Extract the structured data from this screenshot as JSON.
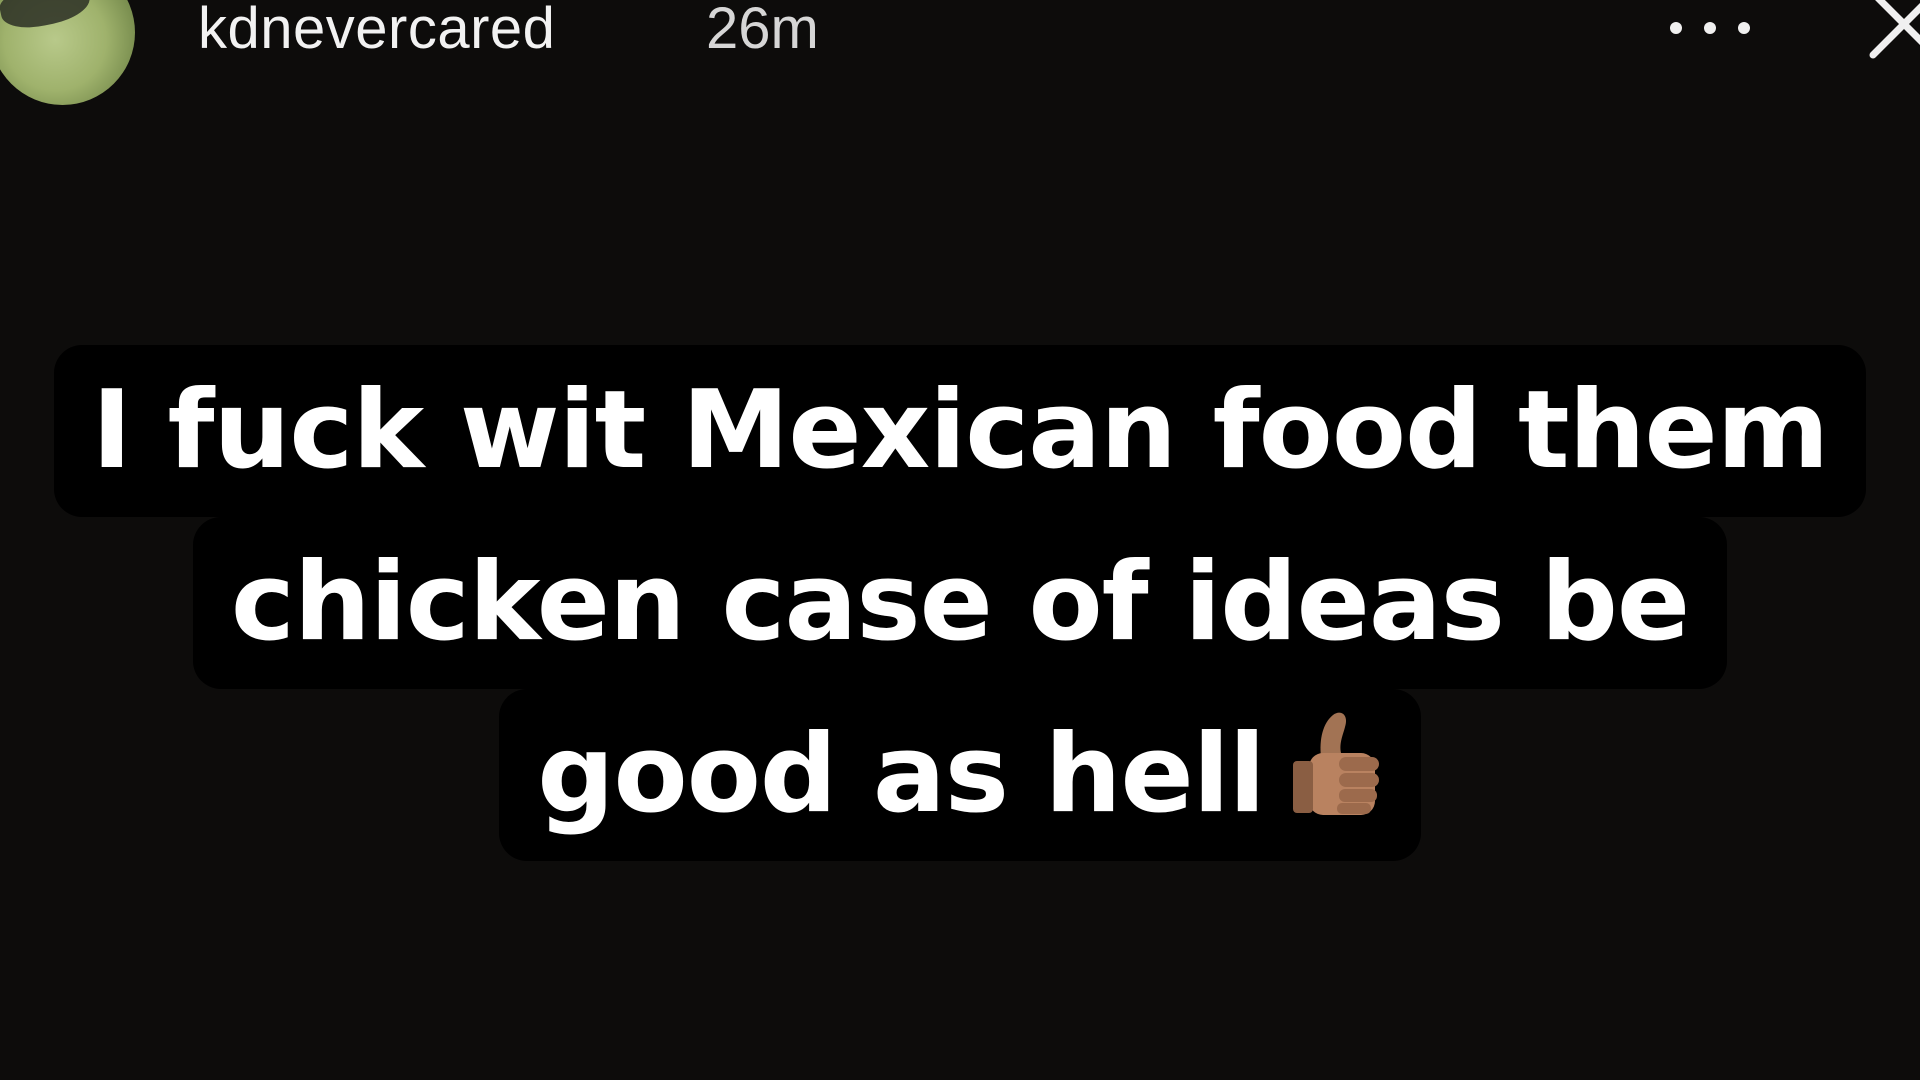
{
  "story_header": {
    "username": "kdnevercared",
    "timestamp": "26m",
    "more_icon": "ellipsis-icon",
    "close_icon": "close-icon"
  },
  "caption": {
    "lines": [
      "I fuck wit Mexican food them",
      "chicken case of ideas be",
      "good as hell"
    ],
    "emoji": "thumbs-up-icon"
  },
  "colors": {
    "background": "#0d0c0b",
    "text_highlight": "#000000",
    "text": "#ffffff"
  }
}
